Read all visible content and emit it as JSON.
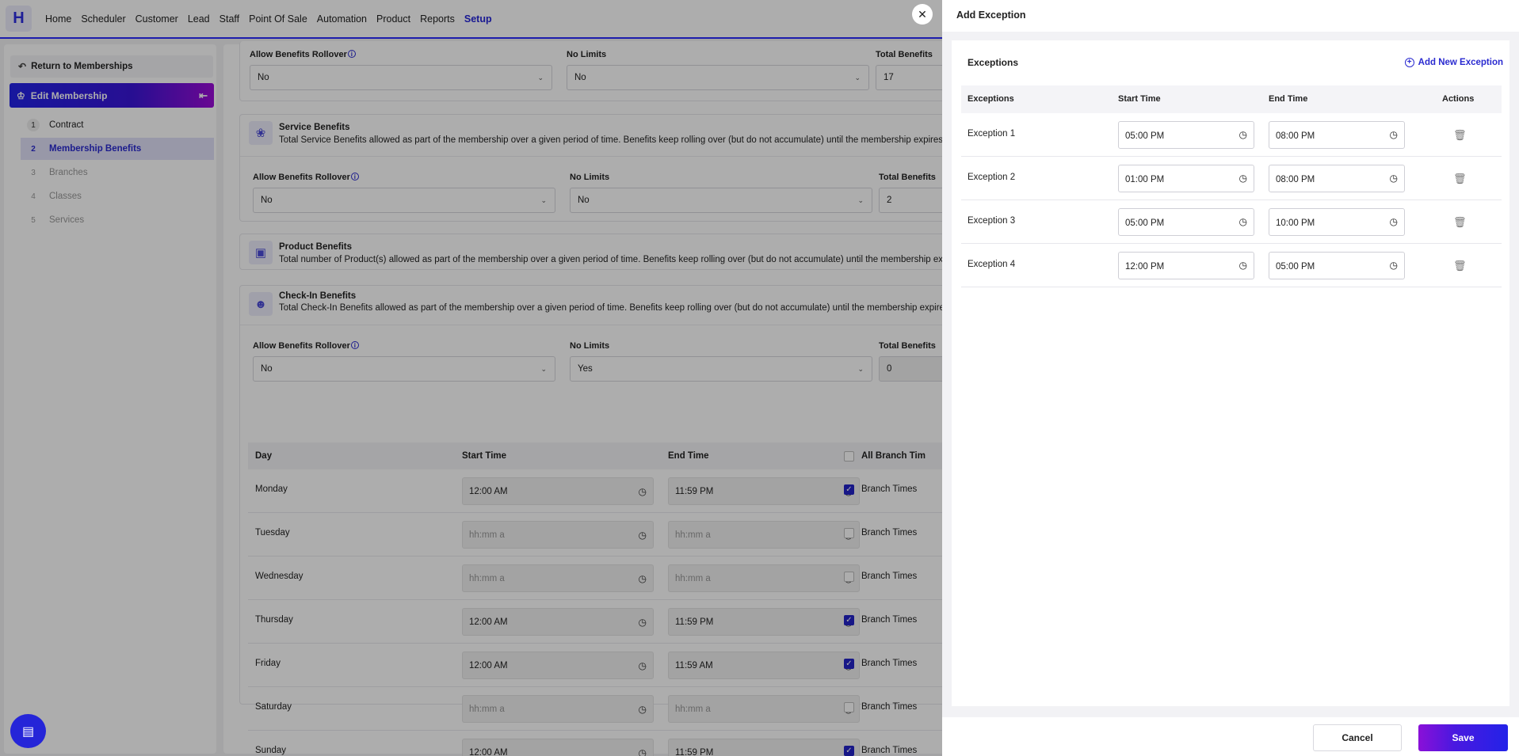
{
  "nav": {
    "logo": "H",
    "items": [
      "Home",
      "Scheduler",
      "Customer",
      "Lead",
      "Staff",
      "Point Of Sale",
      "Automation",
      "Product",
      "Reports",
      "Setup"
    ],
    "active": "Setup"
  },
  "sidebar": {
    "return_label": "Return to Memberships",
    "edit_label": "Edit Membership",
    "steps": [
      {
        "num": "1",
        "label": "Contract"
      },
      {
        "num": "2",
        "label": "Membership Benefits"
      },
      {
        "num": "3",
        "label": "Branches"
      },
      {
        "num": "4",
        "label": "Classes"
      },
      {
        "num": "5",
        "label": "Services"
      }
    ]
  },
  "main": {
    "rollover_label": "Allow Benefits Rollover",
    "no_limits_label": "No Limits",
    "total_benefits_label": "Total Benefits",
    "top_fields": {
      "rollover": "No",
      "no_limits": "No",
      "total": "17"
    },
    "service": {
      "title": "Service Benefits",
      "desc": "Total Service Benefits allowed as part of the membership over a given period of time. Benefits keep rolling over (but do not accumulate) until the membership expires.",
      "rollover": "No",
      "no_limits": "No",
      "total": "2"
    },
    "product": {
      "title": "Product Benefits",
      "desc": "Total number of Product(s) allowed as part of the membership over a given period of time. Benefits keep rolling over (but do not accumulate) until the membership expires."
    },
    "checkin": {
      "title": "Check-In Benefits",
      "desc": "Total Check-In Benefits allowed as part of the membership over a given period of time. Benefits keep rolling over (but do not accumulate) until the membership expires.",
      "rollover": "No",
      "no_limits": "Yes",
      "total": "0"
    },
    "schedule": {
      "headers": {
        "day": "Day",
        "start": "Start Time",
        "end": "End Time",
        "all_branch": "All Branch Tim"
      },
      "branch_label": "Branch Times",
      "rows": [
        {
          "day": "Monday",
          "start": "12:00 AM",
          "end": "11:59 PM",
          "checked": true
        },
        {
          "day": "Tuesday",
          "start": "hh:mm a",
          "end": "hh:mm a",
          "checked": false
        },
        {
          "day": "Wednesday",
          "start": "hh:mm a",
          "end": "hh:mm a",
          "checked": false
        },
        {
          "day": "Thursday",
          "start": "12:00 AM",
          "end": "11:59 PM",
          "checked": true
        },
        {
          "day": "Friday",
          "start": "12:00 AM",
          "end": "11:59 AM",
          "checked": true
        },
        {
          "day": "Saturday",
          "start": "hh:mm a",
          "end": "hh:mm a",
          "checked": false
        },
        {
          "day": "Sunday",
          "start": "12:00 AM",
          "end": "11:59 PM",
          "checked": true
        }
      ]
    }
  },
  "drawer": {
    "title": "Add Exception",
    "section_title": "Exceptions",
    "add_label": "Add New Exception",
    "headers": {
      "name": "Exceptions",
      "start": "Start Time",
      "end": "End Time",
      "actions": "Actions"
    },
    "rows": [
      {
        "name": "Exception 1",
        "start": "05:00 PM",
        "end": "08:00 PM"
      },
      {
        "name": "Exception 2",
        "start": "01:00 PM",
        "end": "08:00 PM"
      },
      {
        "name": "Exception 3",
        "start": "05:00 PM",
        "end": "10:00 PM"
      },
      {
        "name": "Exception 4",
        "start": "12:00 PM",
        "end": "05:00 PM"
      }
    ],
    "cancel_label": "Cancel",
    "save_label": "Save"
  },
  "colors": {
    "accent": "#2525d8",
    "gradient_end": "#9b0bd8"
  },
  "icons": {
    "close": "close-icon",
    "chat": "chat-icon",
    "clock": "clock-icon",
    "trash": "trash-icon"
  }
}
